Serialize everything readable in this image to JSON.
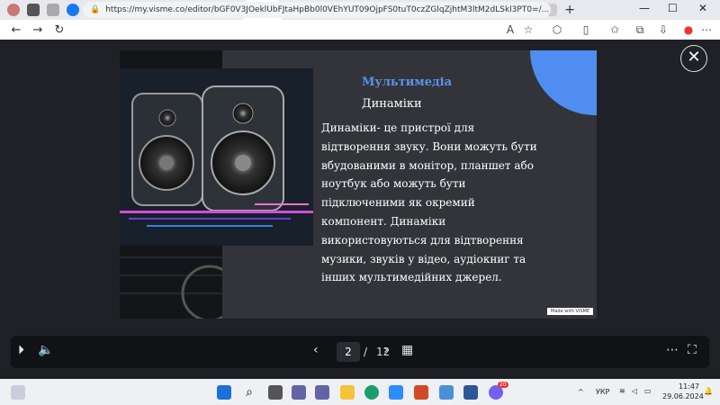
{
  "browser": {
    "url": "https://my.visme.co/editor/bGF0V3JOeklUbFJtaHpBb0l0VEhYUT09OjpFS0tuT0czZGlqZjhtM3ltM2dLSkl3PT0=/...",
    "tab_close": "✕",
    "new_tab": "+",
    "win_min": "—",
    "win_max": "☐",
    "win_close": "✕"
  },
  "slide": {
    "title": "Мультимедіа",
    "subtitle": "Динаміки",
    "body": "Динаміки- це пристрої для відтворення звуку. Вони можуть бути вбудованими в монітор, планшет або ноутбук або можуть бути підключеними як окремий компонент. Динаміки використовуються для відтворення музики, звуків у відео, аудіокниг та інших мультимедійних джерел.",
    "badge": "Made with VISME"
  },
  "pager": {
    "current": "2",
    "separator": "/",
    "total": "12"
  },
  "taskbar": {
    "lang": "УКР",
    "time": "11:47",
    "date": "29.06.2024",
    "notif_count": "20"
  },
  "colors": {
    "accent_blue": "#4f8ef0",
    "title_blue": "#5b93e8",
    "slide_bg": "#33343a"
  }
}
